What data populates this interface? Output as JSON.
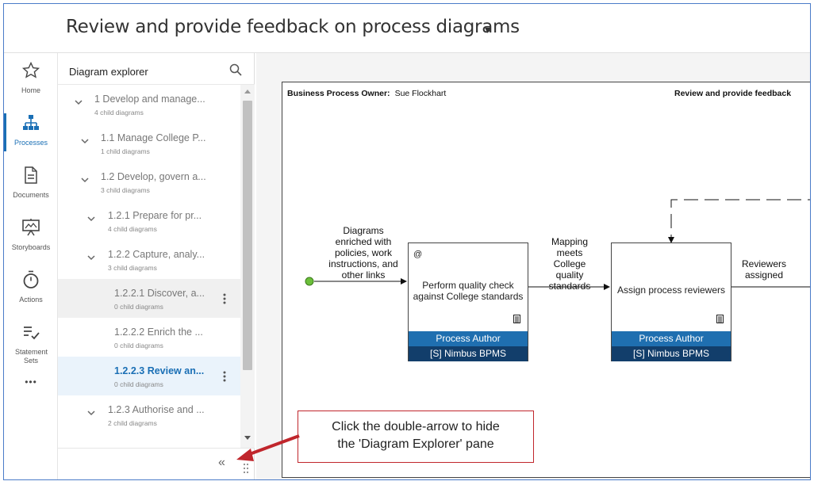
{
  "header": {
    "title": "Review and provide feedback on process diagrams",
    "title_caret": "▾"
  },
  "nav": {
    "items": [
      {
        "label": "Home",
        "icon": "star-icon"
      },
      {
        "label": "Processes",
        "icon": "hierarchy-icon",
        "active": true
      },
      {
        "label": "Documents",
        "icon": "document-icon"
      },
      {
        "label": "Storyboards",
        "icon": "presentation-icon"
      },
      {
        "label": "Actions",
        "icon": "stopwatch-icon"
      },
      {
        "label": "Statement Sets",
        "icon": "checklist-icon"
      },
      {
        "label": "•••",
        "icon": "more-icon"
      }
    ]
  },
  "explorer": {
    "title": "Diagram explorer",
    "collapse_glyph": "«",
    "items": [
      {
        "label": "1 Develop and manage...",
        "sub": "4 child diagrams"
      },
      {
        "label": "1.1 Manage College P...",
        "sub": "1 child diagrams"
      },
      {
        "label": "1.2 Develop, govern a...",
        "sub": "3 child diagrams"
      },
      {
        "label": "1.2.1 Prepare for pr...",
        "sub": "4 child diagrams"
      },
      {
        "label": "1.2.2 Capture, analy...",
        "sub": "3 child diagrams"
      },
      {
        "label": "1.2.2.1 Discover, a...",
        "sub": "0 child diagrams"
      },
      {
        "label": "1.2.2.2 Enrich the ...",
        "sub": "0 child diagrams"
      },
      {
        "label": "1.2.2.3 Review an...",
        "sub": "0 child diagrams"
      },
      {
        "label": "1.2.3 Authorise and ...",
        "sub": "2 child diagrams"
      }
    ]
  },
  "diagram": {
    "owner_label": "Business Process Owner:",
    "owner_name": "Sue Flockhart",
    "title": "Review and provide feedback",
    "input_text": [
      "Diagrams",
      "enriched with",
      "policies, work",
      "instructions, and",
      "other links"
    ],
    "mid_text": [
      "Mapping",
      "meets",
      "College",
      "quality",
      "standards"
    ],
    "output_text": [
      "Reviewers",
      "assigned"
    ],
    "activities": [
      {
        "attach": "@",
        "label": [
          "Perform quality check",
          "against College standards"
        ],
        "role": "Process Author",
        "resource": "[S] Nimbus BPMS"
      },
      {
        "attach": "",
        "label": [
          "Assign process reviewers"
        ],
        "role": "Process Author",
        "resource": "[S] Nimbus BPMS"
      }
    ]
  },
  "callout": {
    "line1": "Click the double-arrow to hide",
    "line2": "the 'Diagram Explorer' pane"
  },
  "colors": {
    "accent": "#1a6fb5",
    "role_bar": "#1f6fb0",
    "resource_bar": "#123e6b",
    "callout_red": "#c0262c",
    "start_dot": "#6bbf3a"
  }
}
